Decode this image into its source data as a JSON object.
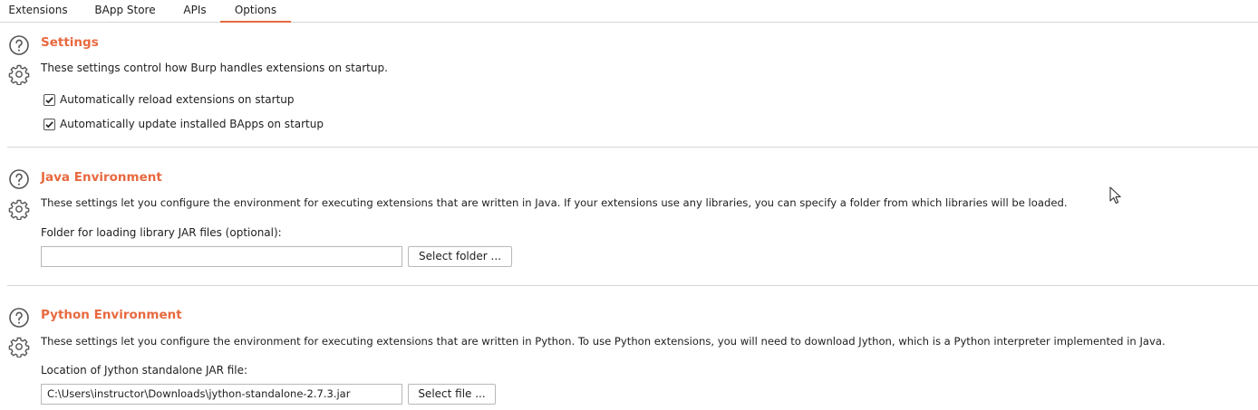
{
  "tabs": [
    {
      "label": "Extensions",
      "active": false
    },
    {
      "label": "BApp Store",
      "active": false
    },
    {
      "label": "APIs",
      "active": false
    },
    {
      "label": "Options",
      "active": true
    }
  ],
  "accent_color": "#e8693f",
  "icons": {
    "help": "question-circle-icon",
    "settings": "gear-icon",
    "checkbox": "checkmark-icon",
    "cursor": "mouse-pointer-icon"
  },
  "settings": {
    "title": "Settings",
    "description": "These settings control how Burp handles extensions on startup.",
    "options": [
      {
        "label": "Automatically reload extensions on startup",
        "checked": true
      },
      {
        "label": "Automatically update installed BApps on startup",
        "checked": true
      }
    ]
  },
  "java": {
    "title": "Java Environment",
    "description": "These settings let you configure the environment for executing extensions that are written in Java. If your extensions use any libraries, you can specify a folder from which libraries will be loaded.",
    "field_label": "Folder for loading library JAR files (optional):",
    "field_value": "",
    "button_label": "Select folder ..."
  },
  "python": {
    "title": "Python Environment",
    "description": "These settings let you configure the environment for executing extensions that are written in Python. To use Python extensions, you will need to download Jython, which is a Python interpreter implemented in Java.",
    "field_label": "Location of Jython standalone JAR file:",
    "field_value": "C:\\Users\\instructor\\Downloads\\jython-standalone-2.7.3.jar",
    "button_label": "Select file ..."
  }
}
